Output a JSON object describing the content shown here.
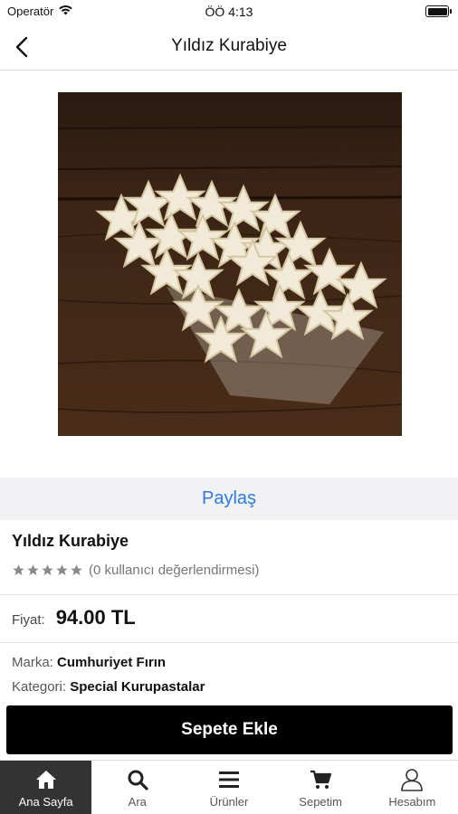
{
  "status_bar": {
    "carrier": "Operatör",
    "time": "ÖÖ 4:13"
  },
  "nav": {
    "title": "Yıldız Kurabiye",
    "back_icon": "chevron-left-icon"
  },
  "product": {
    "image_icon": "star-cookies-photo",
    "share_label": "Paylaş",
    "name": "Yıldız Kurabiye",
    "rating": 0,
    "rating_max": 5,
    "rating_text": "(0 kullanıcı değerlendirmesi)",
    "price_label": "Fiyat:",
    "price_value": "94.00 TL",
    "brand_label": "Marka:",
    "brand_value": "Cumhuriyet Fırın",
    "category_label": "Kategori:",
    "category_value": "Special Kurupastalar",
    "add_to_cart_label": "Sepete Ekle"
  },
  "tabs": [
    {
      "label": "Ana Sayfa",
      "icon": "home-icon",
      "active": true
    },
    {
      "label": "Ara",
      "icon": "search-icon",
      "active": false
    },
    {
      "label": "Ürünler",
      "icon": "menu-icon",
      "active": false
    },
    {
      "label": "Sepetim",
      "icon": "cart-icon",
      "active": false
    },
    {
      "label": "Hesabım",
      "icon": "user-icon",
      "active": false
    }
  ],
  "colors": {
    "accent_link": "#2b7be0",
    "button_bg": "#000000",
    "active_tab_bg": "#333333",
    "star_empty": "#888888"
  }
}
